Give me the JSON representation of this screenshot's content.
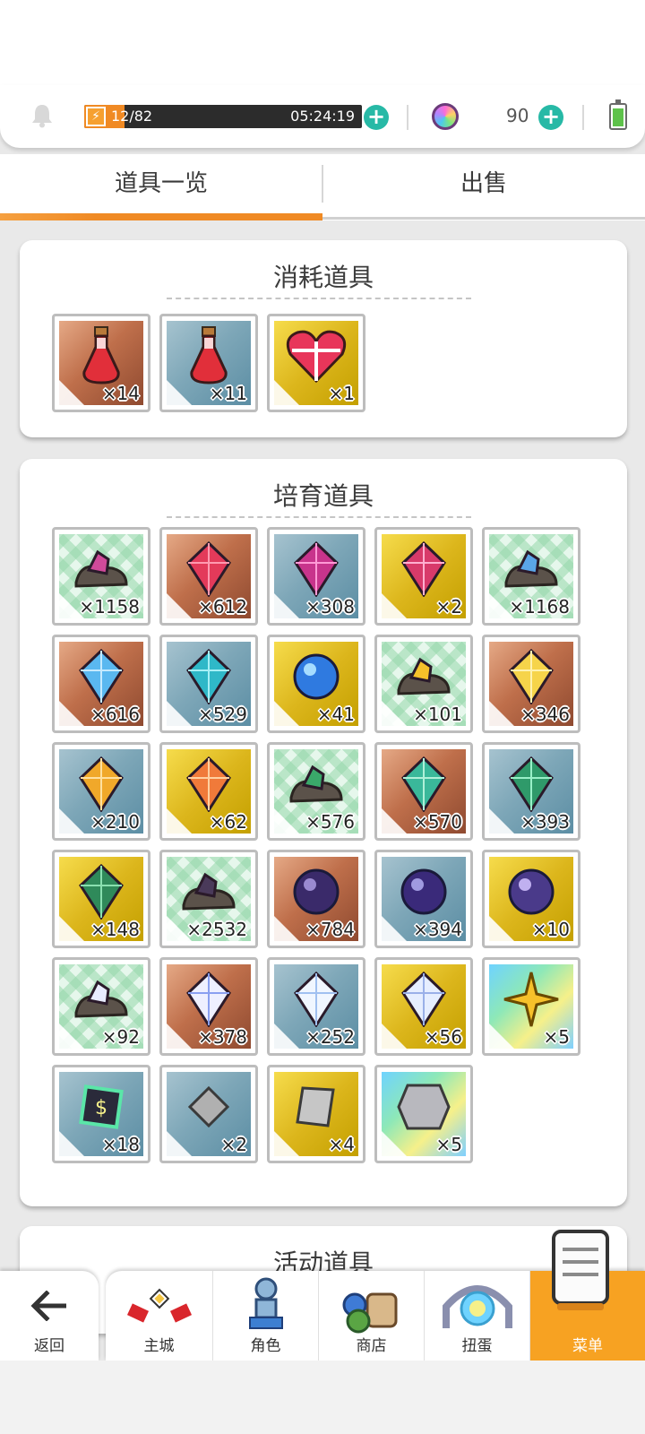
{
  "status": {
    "stamina_text": "12/82",
    "stamina_fill_fraction": 0.146,
    "timer": "05:24:19",
    "gems": "90"
  },
  "tabs": [
    {
      "label": "道具一览",
      "active": true
    },
    {
      "label": "出售",
      "active": false
    }
  ],
  "sections": {
    "consumables": {
      "title": "消耗道具",
      "items": [
        {
          "icon": "red-potion-icon",
          "bg": "copper",
          "qty": "×14"
        },
        {
          "icon": "red-potion-icon",
          "bg": "blue",
          "qty": "×11"
        },
        {
          "icon": "heart-gift-icon",
          "bg": "gold",
          "qty": "×1"
        }
      ]
    },
    "training": {
      "title": "培育道具",
      "items": [
        {
          "icon": "pink-ore-icon",
          "bg": "green",
          "qty": "×1158"
        },
        {
          "icon": "red-gem-icon",
          "bg": "copper",
          "qty": "×612"
        },
        {
          "icon": "pink-crystal-icon",
          "bg": "blue",
          "qty": "×308"
        },
        {
          "icon": "large-pink-crystal-icon",
          "bg": "gold",
          "qty": "×2"
        },
        {
          "icon": "blue-ore-icon",
          "bg": "green",
          "qty": "×1168"
        },
        {
          "icon": "blue-shard-icon",
          "bg": "copper",
          "qty": "×616"
        },
        {
          "icon": "teal-crystal-icon",
          "bg": "blue",
          "qty": "×529"
        },
        {
          "icon": "blue-orb-icon",
          "bg": "gold",
          "qty": "×41"
        },
        {
          "icon": "gold-ore-icon",
          "bg": "green",
          "qty": "×101"
        },
        {
          "icon": "gold-gem-icon",
          "bg": "copper",
          "qty": "×346"
        },
        {
          "icon": "amber-gem-icon",
          "bg": "blue",
          "qty": "×210"
        },
        {
          "icon": "winged-amber-gem-icon",
          "bg": "gold",
          "qty": "×62"
        },
        {
          "icon": "green-ore-icon",
          "bg": "green",
          "qty": "×576"
        },
        {
          "icon": "green-crystal-cluster-icon",
          "bg": "copper",
          "qty": "×570"
        },
        {
          "icon": "emerald-icon",
          "bg": "blue",
          "qty": "×393"
        },
        {
          "icon": "large-emerald-icon",
          "bg": "gold",
          "qty": "×148"
        },
        {
          "icon": "dark-ore-icon",
          "bg": "green",
          "qty": "×2532"
        },
        {
          "icon": "dark-orb-icon",
          "bg": "copper",
          "qty": "×784"
        },
        {
          "icon": "purple-orb-icon",
          "bg": "blue",
          "qty": "×394"
        },
        {
          "icon": "winged-purple-orb-icon",
          "bg": "gold",
          "qty": "×10"
        },
        {
          "icon": "white-ore-icon",
          "bg": "green",
          "qty": "×92"
        },
        {
          "icon": "white-crystal-icon",
          "bg": "copper",
          "qty": "×378"
        },
        {
          "icon": "diamond-icon",
          "bg": "blue",
          "qty": "×252"
        },
        {
          "icon": "winged-diamond-icon",
          "bg": "gold",
          "qty": "×56"
        },
        {
          "icon": "gold-star-icon",
          "bg": "rainbow",
          "qty": "×5"
        },
        {
          "icon": "rainbow-chip-icon",
          "bg": "blue",
          "qty": "×18"
        },
        {
          "icon": "silver-shard-icon",
          "bg": "blue",
          "qty": "×2"
        },
        {
          "icon": "silver-chunk-icon",
          "bg": "gold",
          "qty": "×4"
        },
        {
          "icon": "silver-cube-icon",
          "bg": "rainbow",
          "qty": "×5"
        }
      ]
    },
    "event": {
      "title": "活动道具"
    }
  },
  "nav": {
    "back": "返回",
    "items": [
      {
        "label": "主城",
        "icon": "castle-icon"
      },
      {
        "label": "角色",
        "icon": "character-icon"
      },
      {
        "label": "商店",
        "icon": "shop-icon"
      },
      {
        "label": "扭蛋",
        "icon": "gacha-icon"
      },
      {
        "label": "菜单",
        "icon": "menu-scroll-icon",
        "active": true
      }
    ]
  },
  "colors": {
    "accent_orange": "#f08a24",
    "plus_teal": "#27b9a6",
    "menu_active": "#f7a222"
  }
}
